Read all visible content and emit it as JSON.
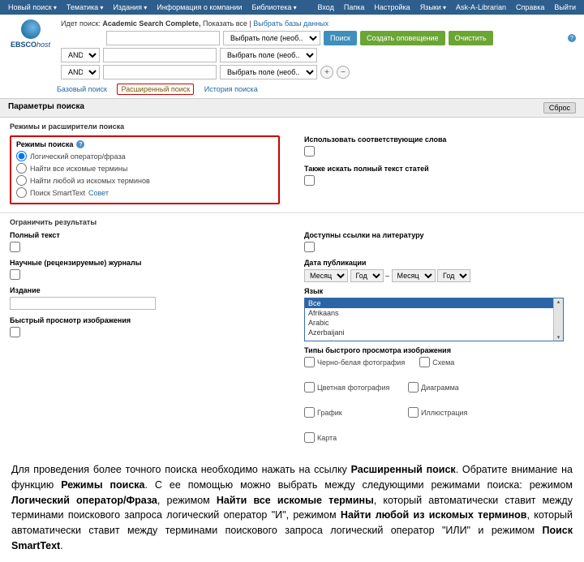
{
  "topnav": {
    "left": [
      "Новый поиск",
      "Тематика",
      "Издания",
      "Информация о компании",
      "Библиотека"
    ],
    "right": [
      "Вход",
      "Папка",
      "Настройка",
      "Языки",
      "Ask-A-Librarian",
      "Справка",
      "Выйти"
    ]
  },
  "logo": {
    "brand": "EBSCO",
    "suffix": "host"
  },
  "search": {
    "meta_prefix": "Идет поиск: ",
    "meta_db": "Academic Search Complete, ",
    "meta_show": "Показать все ",
    "meta_link": "Выбрать базы данных",
    "op_and": "AND",
    "field_placeholder": "Выбрать поле (необ...",
    "btn_search": "Поиск",
    "btn_alert": "Создать оповещение",
    "btn_clear": "Очистить"
  },
  "tabs": {
    "basic": "Базовый поиск",
    "advanced": "Расширенный поиск",
    "history": "История поиска"
  },
  "params": {
    "title": "Параметры поиска",
    "reset": "Сброс"
  },
  "modes": {
    "heading": "Режимы и расширители поиска",
    "label": "Режимы поиска",
    "r1": "Логический оператор/фраза",
    "r2": "Найти все искомые термины",
    "r3": "Найти любой из искомых терминов",
    "r4": "Поиск SmartText",
    "hint": "Совет",
    "related": "Использовать соответствующие слова",
    "fulltext_also": "Также искать полный текст статей"
  },
  "limits": {
    "heading": "Ограничить результаты",
    "fulltext": "Полный текст",
    "peer": "Научные (рецензируемые) журналы",
    "publication": "Издание",
    "refs": "Доступны ссылки на литературу",
    "pubdate": "Дата публикации",
    "month": "Месяц",
    "year": "Год",
    "lang": "Язык",
    "langs": [
      "Все",
      "Afrikaans",
      "Arabic",
      "Azerbaijani"
    ],
    "imgquick": "Быстрый просмотр изображения",
    "imgtypes_label": "Типы быстрого просмотра изображения",
    "imgtypes": [
      "Черно-белая фотография",
      "Цветная фотография",
      "График",
      "Карта",
      "Схема",
      "Диаграмма",
      "Иллюстрация"
    ]
  },
  "caption": {
    "t1": "Для проведения более точного поиска необходимо нажать на ссылку ",
    "b1": "Расширенный поиск",
    "t2": ". Обратите внимание на функцию ",
    "b2": "Режимы поиска",
    "t3": ". С ее помощью можно выбрать между следующими режимами поиска: режимом ",
    "b3": "Логический оператор/Фраза",
    "t4": ", режимом ",
    "b4": "Найти все искомые термины",
    "t5": ", который автоматически ставит между терминами поискового запроса логический оператор \"И\", режимом ",
    "b5": "Найти любой из искомых терминов",
    "t6": ", который автоматически ставит между терминами поискового запроса логический оператор \"ИЛИ\" и режимом ",
    "b6": "Поиск SmartText",
    "t7": "."
  }
}
